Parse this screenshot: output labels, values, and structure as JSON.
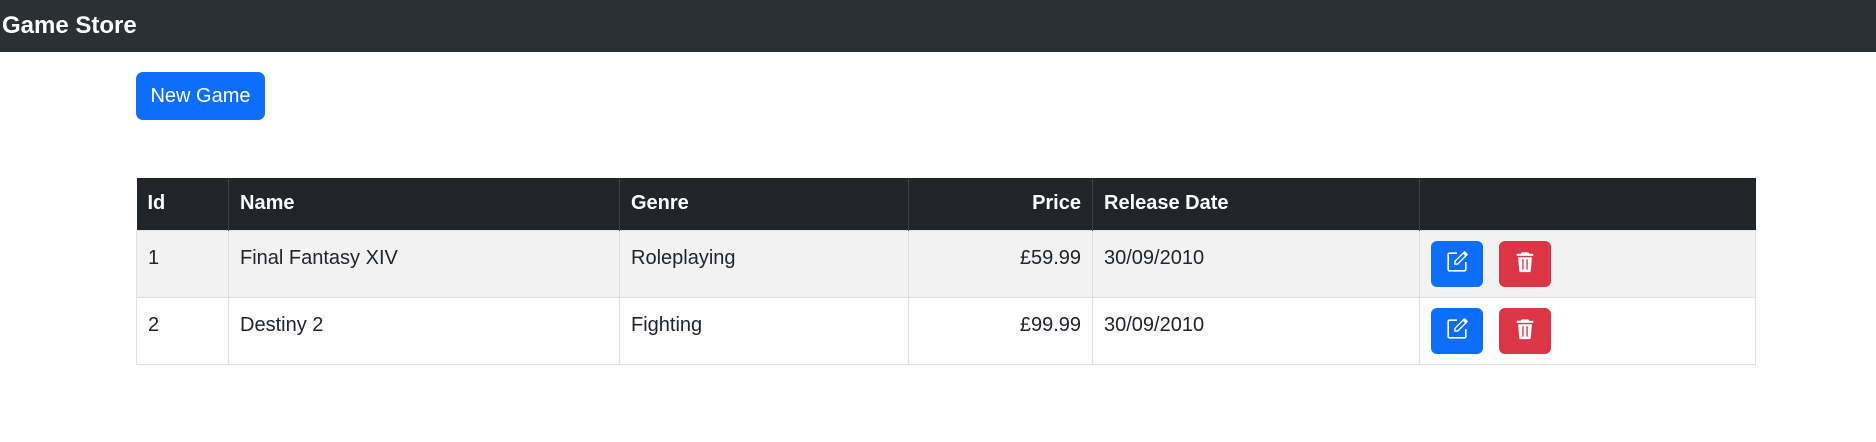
{
  "navbar": {
    "brand": "Game Store"
  },
  "toolbar": {
    "new_label": "New Game"
  },
  "table": {
    "headers": {
      "id": "Id",
      "name": "Name",
      "genre": "Genre",
      "price": "Price",
      "release": "Release Date",
      "actions": ""
    },
    "rows": [
      {
        "id": "1",
        "name": "Final Fantasy XIV",
        "genre": "Roleplaying",
        "price": "£59.99",
        "release": "30/09/2010"
      },
      {
        "id": "2",
        "name": "Destiny 2",
        "genre": "Fighting",
        "price": "£99.99",
        "release": "30/09/2010"
      }
    ]
  },
  "icons": {
    "edit": "pencil-square-icon",
    "delete": "trash-icon"
  },
  "colors": {
    "primary": "#0d6efd",
    "danger": "#dc3545",
    "navbar": "#2b3035",
    "table_header": "#212529"
  }
}
